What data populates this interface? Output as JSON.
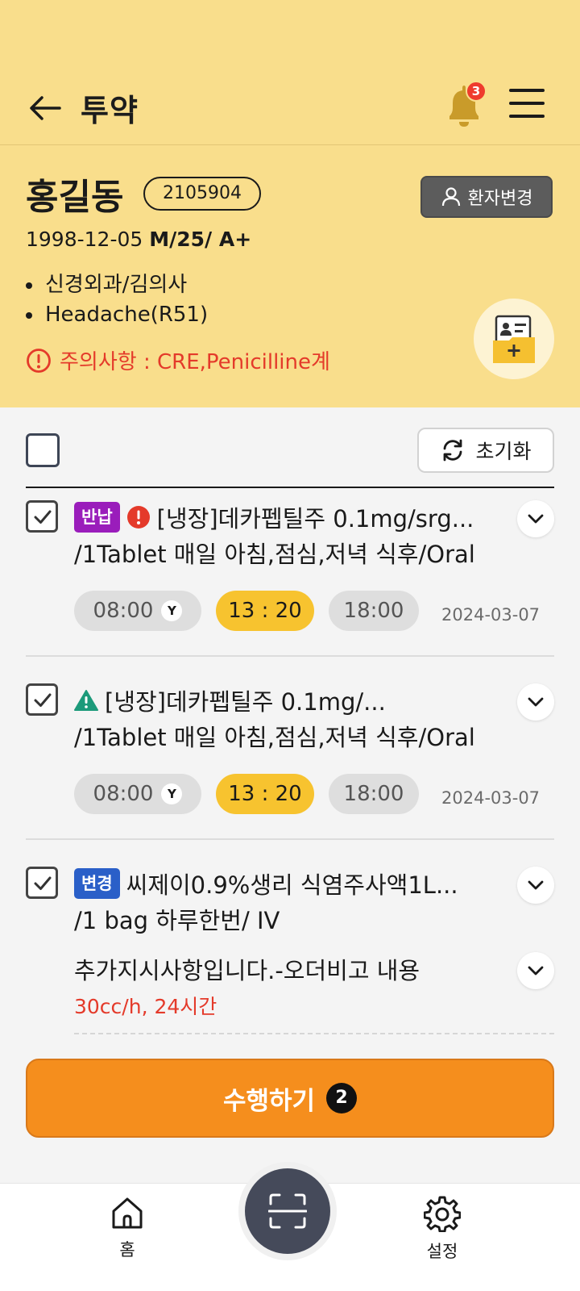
{
  "header": {
    "title": "투약",
    "notification_count": "3"
  },
  "patient": {
    "name": "홍길동",
    "id": "2105904",
    "change_label": "환자변경",
    "birth": "1998-12-05",
    "sex_age_blood": "M/25/ A+",
    "department": "신경외과/김의사",
    "diagnosis": "Headache(R51)",
    "caution": "주의사항 : CRE,Penicilline계"
  },
  "list": {
    "reset_label": "초기화"
  },
  "medications": [
    {
      "badge": "반납",
      "title": "[냉장]데카펩틸주 0.1mg/srg...",
      "sub": "/1Tablet 매일 아침,점심,저녁 식후/Oral",
      "times": [
        "08:00",
        "13 : 20",
        "18:00"
      ],
      "done_mark": "Y",
      "date": "2024-03-07"
    },
    {
      "title": "[냉장]데카펩틸주 0.1mg/...",
      "sub": "/1Tablet 매일 아침,점심,저녁 식후/Oral",
      "times": [
        "08:00",
        "13 : 20",
        "18:00"
      ],
      "done_mark": "Y",
      "date": "2024-03-07"
    },
    {
      "badge": "변경",
      "title": "씨제이0.9%생리 식염주사액1L...",
      "sub": "/1 bag 하루한번/ IV",
      "extra": "추가지시사항입니다.-오더비고 내용",
      "extra_red": "30cc/h, 24시간"
    }
  ],
  "action": {
    "perform_label": "수행하기",
    "perform_count": "2"
  },
  "nav": {
    "home_label": "홈",
    "settings_label": "설정"
  },
  "colors": {
    "header_bg": "#f9de8c",
    "primary_button": "#f58e1d",
    "active_time": "#f7c32f",
    "caution": "#e43a2a",
    "badge_return": "#9a1dbb",
    "badge_change": "#2a5fc8"
  }
}
